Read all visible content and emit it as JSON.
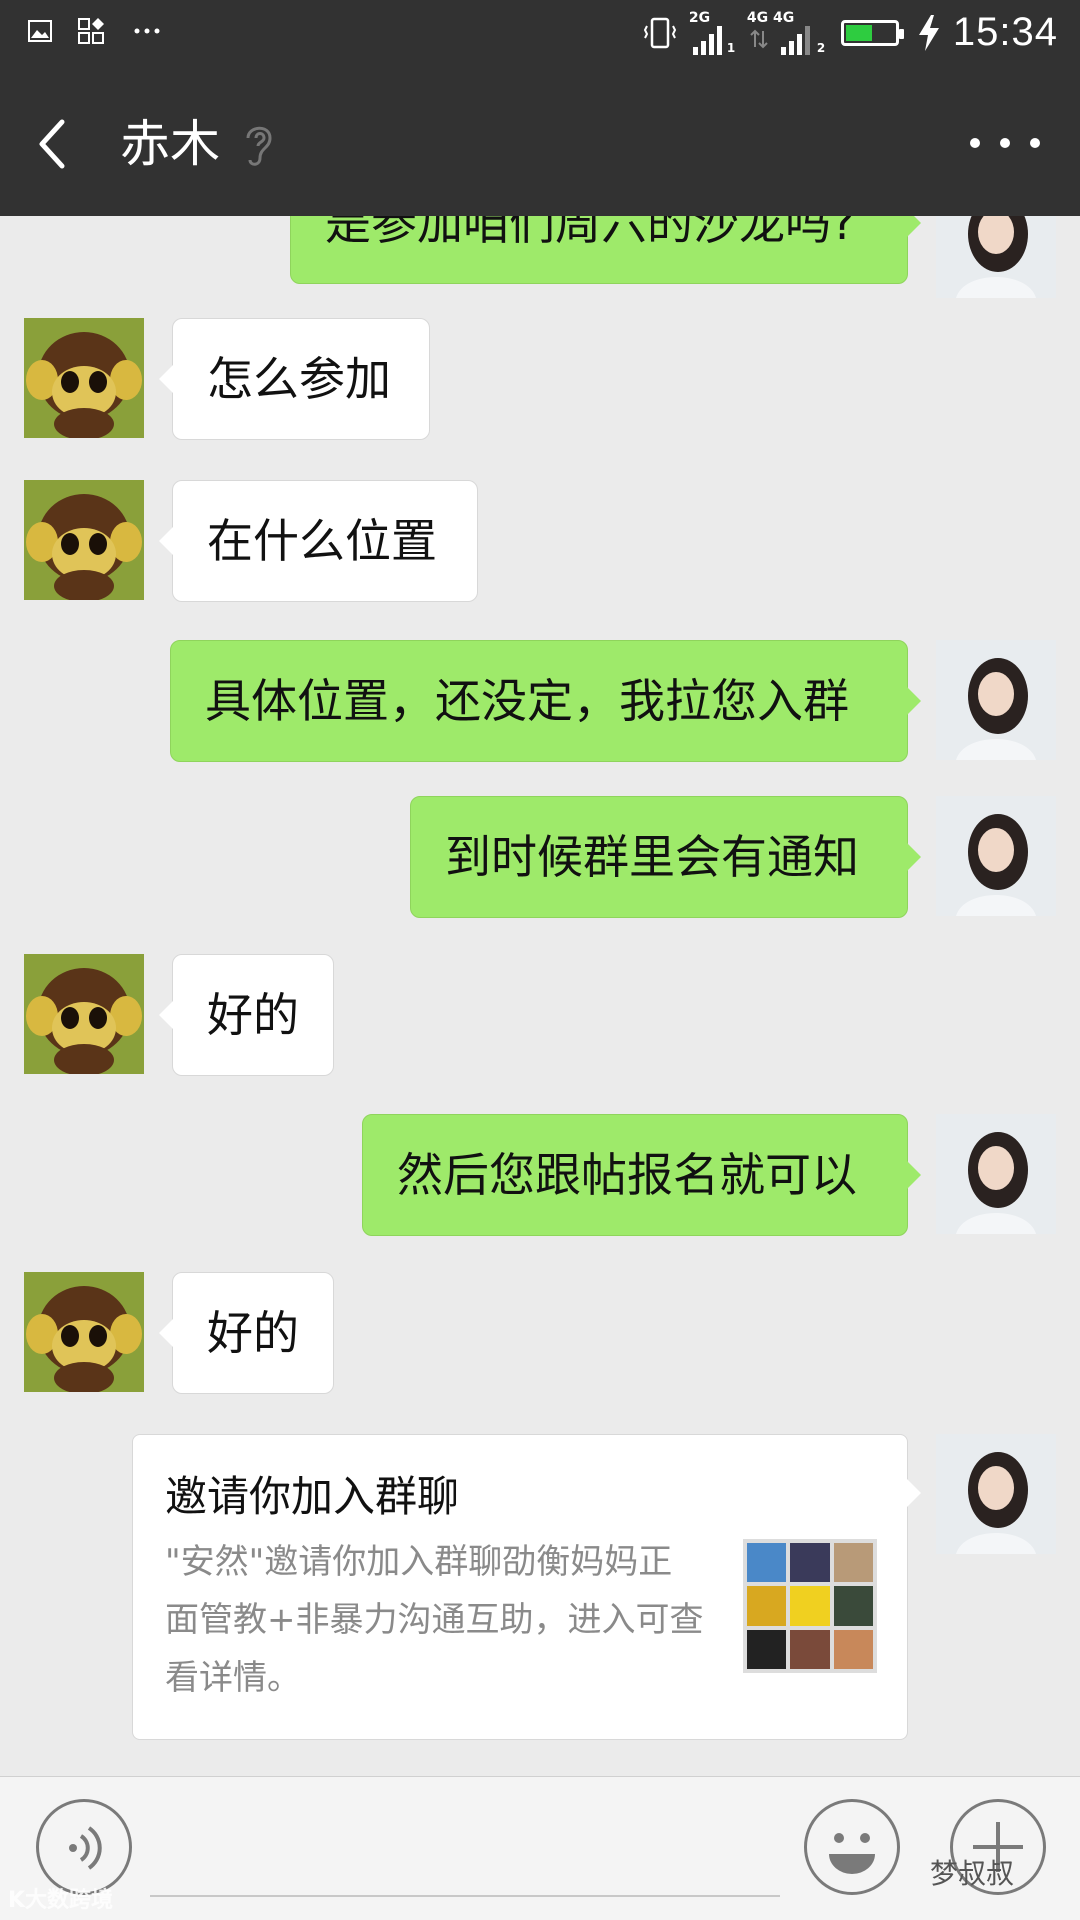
{
  "status_bar": {
    "time": "15:34",
    "sim1_type": "2G",
    "sim1_index": "1",
    "sim2_type": "4G 4G",
    "sim2_index": "2",
    "battery_level": 0.5
  },
  "header": {
    "contact_name": "赤木"
  },
  "messages": [
    {
      "side": "right",
      "text": "是参加咱们周六的沙龙吗?"
    },
    {
      "side": "left",
      "text": "怎么参加"
    },
    {
      "side": "left",
      "text": "在什么位置"
    },
    {
      "side": "right",
      "text": "具体位置，还没定，我拉您入群"
    },
    {
      "side": "right",
      "text": "到时候群里会有通知"
    },
    {
      "side": "left",
      "text": "好的"
    },
    {
      "side": "right",
      "text": "然后您跟帖报名就可以"
    },
    {
      "side": "left",
      "text": "好的"
    }
  ],
  "invite_card": {
    "title": "邀请你加入群聊",
    "description": "\"安然\"邀请你加入群聊劭衡妈妈正面管教+非暴力沟通互助，进入可查看详情。"
  },
  "watermarks": {
    "left": "K大数跨境",
    "right": "梦叔叔"
  },
  "colors": {
    "header_bg": "#323232",
    "chat_bg": "#ebebeb",
    "sent_bubble": "#9eea6a",
    "received_bubble": "#ffffff"
  }
}
